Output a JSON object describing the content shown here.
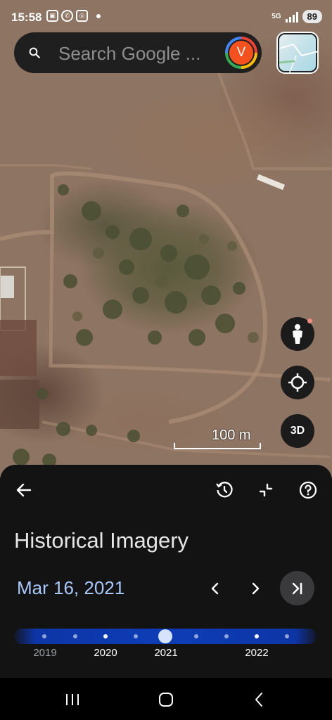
{
  "status_bar": {
    "time": "15:58",
    "notification_icons": [
      "screenshot-icon",
      "whatsapp-icon",
      "instagram-icon"
    ],
    "network": "5G",
    "battery": "89"
  },
  "search": {
    "placeholder": "Search Google ...",
    "avatar_letter": "V"
  },
  "map": {
    "scale_label": "100 m",
    "btn_3d": "3D"
  },
  "sheet": {
    "title": "Historical Imagery",
    "date": "Mar 16, 2021",
    "selected_year": "2021",
    "years": [
      "2019",
      "2020",
      "2021",
      "2022"
    ]
  },
  "colors": {
    "accent_date": "#a8c7fa",
    "timeline": "#0d3db6",
    "sheet_bg": "#131314",
    "avatar": "#f4511e"
  }
}
